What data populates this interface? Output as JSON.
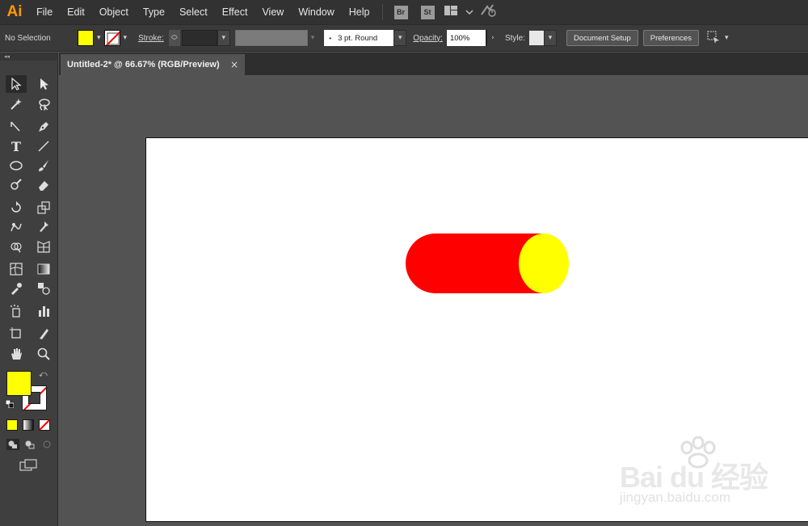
{
  "app": {
    "logo": "Ai"
  },
  "menubar": {
    "items": [
      "File",
      "Edit",
      "Object",
      "Type",
      "Select",
      "Effect",
      "View",
      "Window",
      "Help"
    ],
    "bridge": "Br",
    "stock": "St"
  },
  "controlbar": {
    "selection": "No Selection",
    "stroke_label": "Stroke:",
    "brush": "3 pt. Round",
    "opacity_label": "Opacity:",
    "opacity_value": "100%",
    "style_label": "Style:",
    "document_setup": "Document Setup",
    "preferences": "Preferences"
  },
  "document": {
    "tab_title": "Untitled-2* @ 66.67% (RGB/Preview)",
    "close": "×"
  },
  "colors": {
    "fill": "#ffff00",
    "cylinder_body": "#ff0000",
    "cylinder_cap": "#ffff00",
    "accent": "#ff9a00"
  },
  "icons": [
    "selection-tool-icon",
    "direct-selection-tool-icon",
    "magic-wand-icon",
    "lasso-icon",
    "pen-icon",
    "type-icon",
    "line-icon",
    "ellipse-icon",
    "paintbrush-icon",
    "blob-brush-icon",
    "eraser-icon",
    "rotate-icon",
    "scale-icon",
    "warp-icon",
    "puppet-warp-icon",
    "shape-builder-icon",
    "perspective-grid-icon",
    "mesh-icon",
    "gradient-icon",
    "eyedropper-icon",
    "blend-icon",
    "symbol-sprayer-icon",
    "column-graph-icon",
    "artboard-icon",
    "slice-icon",
    "hand-icon",
    "zoom-icon"
  ],
  "watermark": {
    "main": "Bai du 经验",
    "sub": "jingyan.baidu.com"
  }
}
